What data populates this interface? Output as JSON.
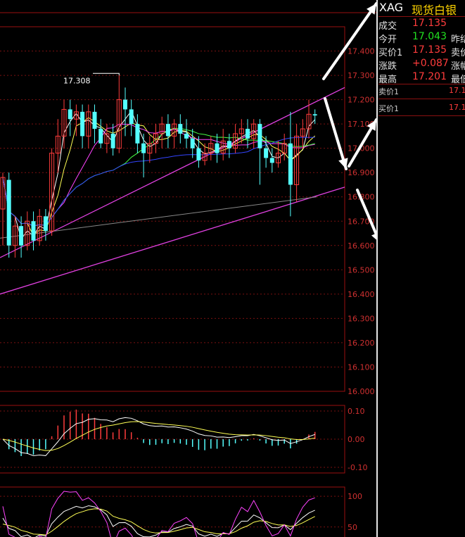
{
  "quote": {
    "code": "XAG",
    "name": "现货白银",
    "rows": [
      {
        "label": "成交",
        "value": "17.135",
        "color": "#ff3c3c",
        "label2": ""
      },
      {
        "label": "今开",
        "value": "17.043",
        "color": "#21e021",
        "label2": "昨结"
      },
      {
        "label": "买价1",
        "value": "17.135",
        "color": "#ff3c3c",
        "label2": "卖价"
      },
      {
        "label": "涨跌",
        "value": "+0.087",
        "color": "#ff3c3c",
        "label2": "涨幅"
      },
      {
        "label": "最高",
        "value": "17.201",
        "color": "#ff3c3c",
        "label2": "最低"
      }
    ],
    "orderbook": [
      {
        "label": "卖价1",
        "value": "17.1"
      },
      {
        "label": "买价1",
        "value": "17.1"
      }
    ]
  },
  "chart_data": [
    {
      "type": "candlestick",
      "ylim": [
        16.0,
        17.5
      ],
      "y_ticks": [
        "16.000",
        "16.100",
        "16.200",
        "16.300",
        "16.400",
        "16.500",
        "16.600",
        "16.700",
        "16.800",
        "16.900",
        "17.000",
        "17.100",
        "17.200",
        "17.300",
        "17.400"
      ],
      "annotation": {
        "text": "17.308",
        "value": 17.308
      },
      "candles": [
        [
          16.75,
          16.88,
          16.6,
          16.9
        ],
        [
          16.87,
          16.6,
          16.55,
          16.9
        ],
        [
          16.6,
          16.68,
          16.55,
          16.72
        ],
        [
          16.68,
          16.6,
          16.55,
          16.72
        ],
        [
          16.6,
          16.7,
          16.58,
          16.74
        ],
        [
          16.7,
          16.62,
          16.58,
          16.74
        ],
        [
          16.62,
          16.72,
          16.6,
          16.75
        ],
        [
          16.72,
          16.66,
          16.62,
          16.75
        ],
        [
          16.66,
          16.98,
          16.64,
          17.0
        ],
        [
          16.98,
          17.05,
          16.9,
          17.12
        ],
        [
          17.05,
          17.16,
          17.0,
          17.2
        ],
        [
          17.16,
          17.12,
          17.05,
          17.2
        ],
        [
          17.12,
          17.15,
          17.05,
          17.18
        ],
        [
          17.15,
          17.05,
          17.0,
          17.18
        ],
        [
          17.05,
          17.15,
          17.0,
          17.18
        ],
        [
          17.15,
          17.08,
          17.02,
          17.18
        ],
        [
          17.08,
          17.02,
          17.0,
          17.12
        ],
        [
          17.02,
          17.06,
          16.98,
          17.1
        ],
        [
          17.06,
          17.0,
          16.97,
          17.1
        ],
        [
          17.0,
          17.2,
          16.98,
          17.3
        ],
        [
          17.2,
          17.16,
          17.05,
          17.25
        ],
        [
          17.16,
          17.1,
          17.05,
          17.2
        ],
        [
          17.1,
          17.02,
          16.98,
          17.14
        ],
        [
          17.02,
          16.98,
          16.88,
          17.06
        ],
        [
          16.98,
          17.02,
          16.94,
          17.05
        ],
        [
          17.02,
          17.06,
          16.98,
          17.1
        ],
        [
          17.06,
          17.1,
          17.0,
          17.13
        ],
        [
          17.1,
          17.05,
          17.0,
          17.14
        ],
        [
          17.05,
          17.1,
          17.0,
          17.12
        ],
        [
          17.1,
          17.06,
          17.02,
          17.14
        ],
        [
          17.06,
          17.04,
          17.0,
          17.12
        ],
        [
          17.04,
          17.0,
          16.96,
          17.08
        ],
        [
          17.0,
          16.95,
          16.92,
          17.05
        ],
        [
          16.95,
          16.98,
          16.93,
          17.02
        ],
        [
          16.98,
          17.02,
          16.95,
          17.05
        ],
        [
          17.02,
          16.98,
          16.94,
          17.06
        ],
        [
          16.98,
          17.03,
          16.95,
          17.08
        ],
        [
          17.03,
          17.0,
          16.96,
          17.06
        ],
        [
          17.0,
          17.06,
          16.98,
          17.1
        ],
        [
          17.06,
          17.08,
          17.02,
          17.12
        ],
        [
          17.08,
          17.04,
          17.0,
          17.12
        ],
        [
          17.04,
          17.1,
          17.0,
          17.12
        ],
        [
          17.1,
          17.0,
          16.85,
          17.12
        ],
        [
          17.0,
          16.96,
          16.92,
          17.05
        ],
        [
          16.96,
          16.94,
          16.9,
          17.0
        ],
        [
          16.94,
          16.98,
          16.92,
          17.03
        ],
        [
          16.98,
          17.02,
          16.95,
          17.06
        ],
        [
          17.02,
          16.85,
          16.72,
          17.15
        ],
        [
          16.85,
          17.05,
          16.78,
          17.1
        ],
        [
          17.05,
          17.08,
          17.0,
          17.12
        ],
        [
          17.08,
          17.14,
          17.04,
          17.2
        ],
        [
          17.14,
          17.135,
          17.1,
          17.16
        ]
      ]
    },
    {
      "type": "macd",
      "y_ticks": [
        "0.10",
        "0.00",
        "-0.10"
      ],
      "ylim": [
        -0.12,
        0.12
      ]
    },
    {
      "type": "kdj",
      "y_ticks": [
        "100",
        "50"
      ],
      "ylim": [
        20,
        115
      ]
    }
  ]
}
